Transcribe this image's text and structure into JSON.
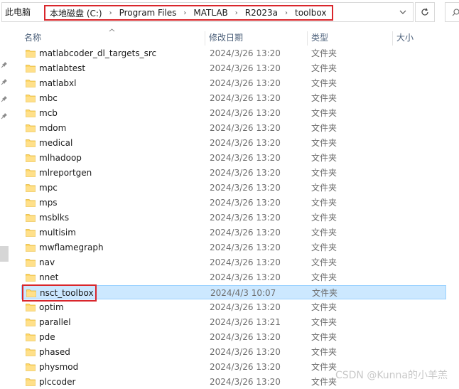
{
  "address_bar": {
    "root": "此电脑",
    "crumbs": [
      "本地磁盘 (C:)",
      "Program Files",
      "MATLAB",
      "R2023a",
      "toolbox"
    ],
    "separator": "›",
    "dropdown_icon": "chevron-down-icon",
    "refresh_icon": "refresh-icon"
  },
  "columns": {
    "name": "名称",
    "date_modified": "修改日期",
    "type": "类型",
    "size": "大小"
  },
  "files": [
    {
      "name": "matlabcoder_dl_targets_src",
      "date": "2024/3/26 13:20",
      "type": "文件夹"
    },
    {
      "name": "matlabtest",
      "date": "2024/3/26 13:20",
      "type": "文件夹"
    },
    {
      "name": "matlabxl",
      "date": "2024/3/26 13:20",
      "type": "文件夹"
    },
    {
      "name": "mbc",
      "date": "2024/3/26 13:20",
      "type": "文件夹"
    },
    {
      "name": "mcb",
      "date": "2024/3/26 13:20",
      "type": "文件夹"
    },
    {
      "name": "mdom",
      "date": "2024/3/26 13:20",
      "type": "文件夹"
    },
    {
      "name": "medical",
      "date": "2024/3/26 13:20",
      "type": "文件夹"
    },
    {
      "name": "mlhadoop",
      "date": "2024/3/26 13:20",
      "type": "文件夹"
    },
    {
      "name": "mlreportgen",
      "date": "2024/3/26 13:20",
      "type": "文件夹"
    },
    {
      "name": "mpc",
      "date": "2024/3/26 13:20",
      "type": "文件夹"
    },
    {
      "name": "mps",
      "date": "2024/3/26 13:20",
      "type": "文件夹"
    },
    {
      "name": "msblks",
      "date": "2024/3/26 13:20",
      "type": "文件夹"
    },
    {
      "name": "multisim",
      "date": "2024/3/26 13:20",
      "type": "文件夹"
    },
    {
      "name": "mwflamegraph",
      "date": "2024/3/26 13:20",
      "type": "文件夹"
    },
    {
      "name": "nav",
      "date": "2024/3/26 13:20",
      "type": "文件夹"
    },
    {
      "name": "nnet",
      "date": "2024/3/26 13:20",
      "type": "文件夹"
    },
    {
      "name": "nsct_toolbox",
      "date": "2024/4/3 10:07",
      "type": "文件夹",
      "selected": true
    },
    {
      "name": "optim",
      "date": "2024/3/26 13:20",
      "type": "文件夹"
    },
    {
      "name": "parallel",
      "date": "2024/3/26 13:21",
      "type": "文件夹"
    },
    {
      "name": "pde",
      "date": "2024/3/26 13:20",
      "type": "文件夹"
    },
    {
      "name": "phased",
      "date": "2024/3/26 13:20",
      "type": "文件夹"
    },
    {
      "name": "physmod",
      "date": "2024/3/26 13:20",
      "type": "文件夹"
    },
    {
      "name": "plccoder",
      "date": "2024/3/26 13:20",
      "type": "文件夹"
    }
  ],
  "watermark": "CSDN @Kunna的小羊羔",
  "colors": {
    "selection_bg": "#cce8ff",
    "selection_border": "#99d1ff",
    "highlight_red": "#d9262b",
    "folder_yellow": "#ffd766"
  }
}
